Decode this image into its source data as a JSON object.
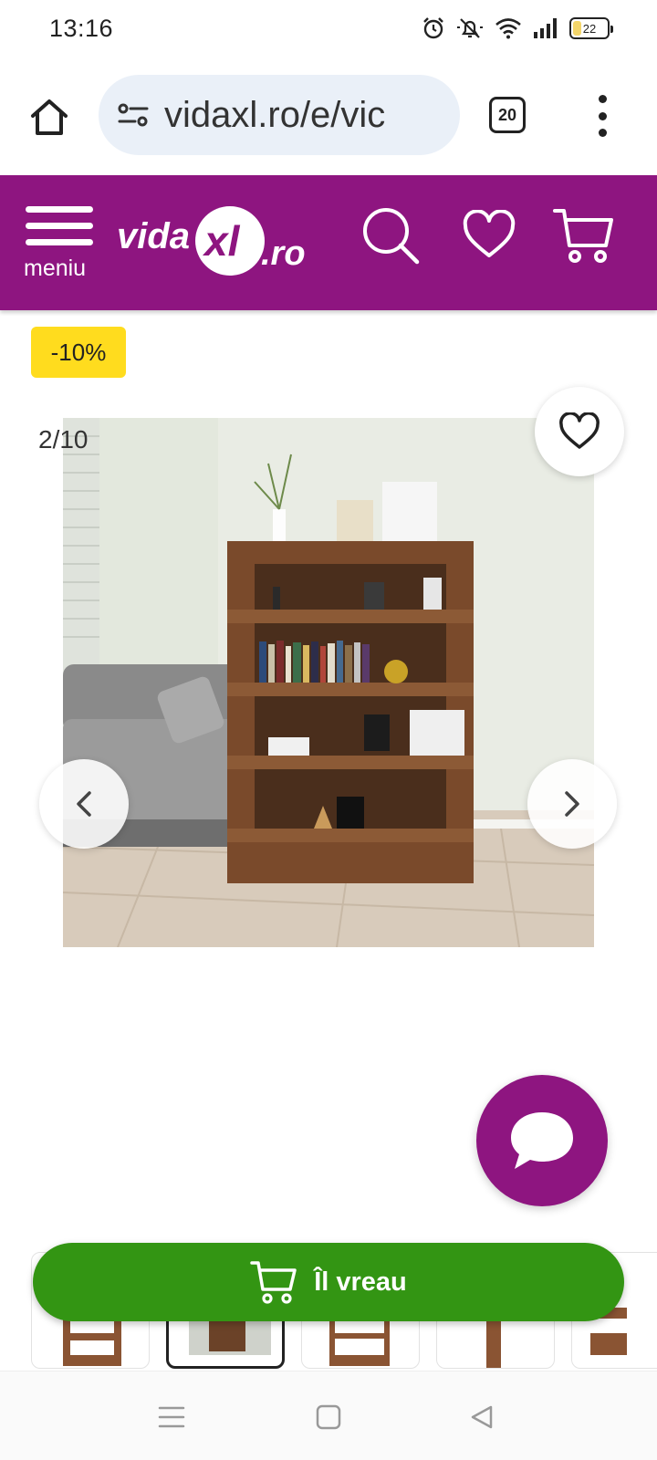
{
  "status_bar": {
    "time": "13:16",
    "battery_level": "22"
  },
  "browser": {
    "url": "vidaxl.ro/e/vic",
    "tab_count": "20"
  },
  "site_header": {
    "menu_label": "meniu",
    "logo_text": "vidaXL.ro",
    "brand_color": "#8e1580"
  },
  "product": {
    "discount_badge": "-10%",
    "gallery_counter": "2/10",
    "image_subject": "brown oak bookcase room divider with books and decor beside grey sofa",
    "thumbnail_count_visible": 5,
    "active_thumbnail_index": 1
  },
  "cta": {
    "label": "Îl vreau",
    "color": "#339513"
  },
  "icons": {
    "home": "home-icon",
    "site_settings": "tune-icon",
    "search": "search-icon",
    "wishlist": "heart-icon",
    "cart": "cart-icon",
    "chat": "chat-bubble-icon",
    "prev": "chevron-left-icon",
    "next": "chevron-right-icon"
  }
}
